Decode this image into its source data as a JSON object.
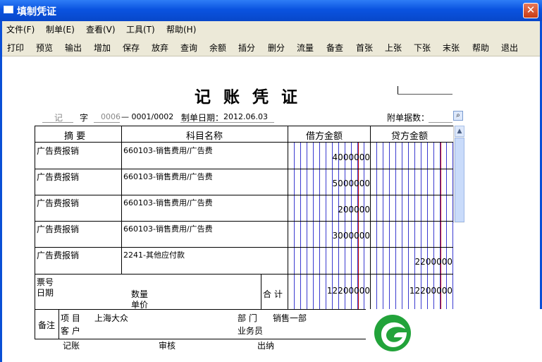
{
  "window": {
    "title": "填制凭证",
    "close": "✕"
  },
  "menu": [
    "文件(F)",
    "制单(E)",
    "查看(V)",
    "工具(T)",
    "帮助(H)"
  ],
  "toolbar": [
    "打印",
    "预览",
    "输出",
    "增加",
    "保存",
    "放弃",
    "查询",
    "余额",
    "插分",
    "删分",
    "流量",
    "备查",
    "首张",
    "上张",
    "下张",
    "末张",
    "帮助",
    "退出"
  ],
  "voucher": {
    "title": "记 账 凭 证",
    "type": "记",
    "zi": "字",
    "number_prefix": "0006",
    "number": "— 0001/0002",
    "date_label": "制单日期：",
    "date": "2012.06.03",
    "attach_label": "附单据数：",
    "headers": {
      "summary": "摘 要",
      "account": "科目名称",
      "debit": "借方金额",
      "credit": "贷方金额"
    },
    "rows": [
      {
        "summary": "广告费报销",
        "account": "660103-销售费用/广告费",
        "debit": "4000000",
        "credit": ""
      },
      {
        "summary": "广告费报销",
        "account": "660103-销售费用/广告费",
        "debit": "5000000",
        "credit": ""
      },
      {
        "summary": "广告费报销",
        "account": "660103-销售费用/广告费",
        "debit": "200000",
        "credit": ""
      },
      {
        "summary": "广告费报销",
        "account": "660103-销售费用/广告费",
        "debit": "3000000",
        "credit": ""
      },
      {
        "summary": "广告费报销",
        "account": "2241-其他应付款",
        "debit": "",
        "credit": "2200000"
      }
    ],
    "footer": {
      "ticket": "票号",
      "date": "日期",
      "qty": "数量",
      "price": "单价",
      "total_label": "合 计",
      "total_debit": "12200000",
      "total_credit": "12200000"
    },
    "remarks": {
      "label": "备注",
      "project_label": "项  目",
      "project": "上海大众",
      "dept_label": "部  门",
      "dept": "销售一部",
      "customer_label": "客  户",
      "salesman_label": "业务员"
    },
    "signatures": [
      "记账",
      "审核",
      "出纳"
    ]
  },
  "colors": {
    "title_blue": "#0a53e0",
    "grid_blue": "#3333cc",
    "grid_red": "#cc0000",
    "logo_green": "#22a33a"
  }
}
